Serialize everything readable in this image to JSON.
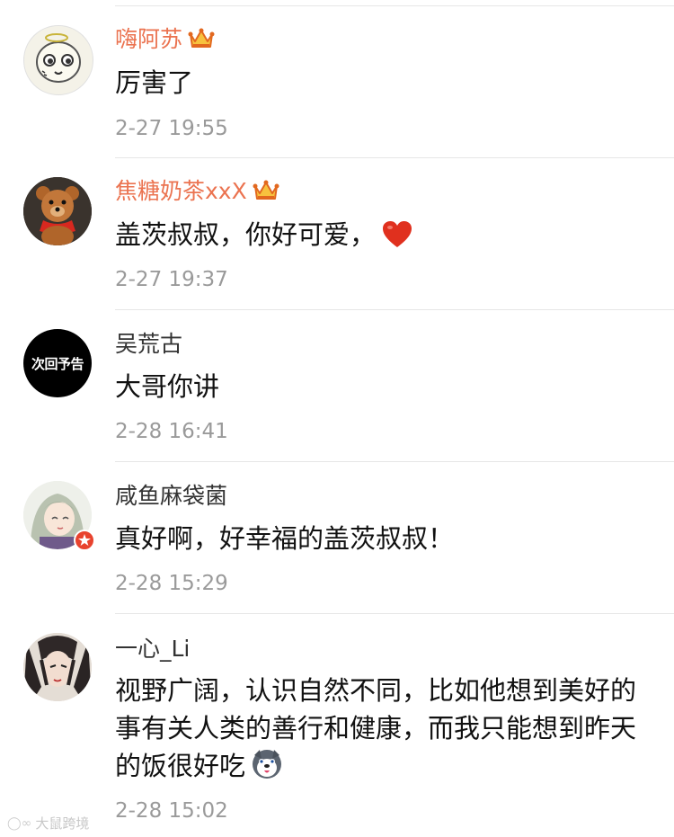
{
  "comments": [
    {
      "username": "嗨阿苏",
      "vip": true,
      "text": "厉害了",
      "time": "2-27 19:55",
      "avatar_icon": "doodle-face-avatar"
    },
    {
      "username": "焦糖奶茶xxX",
      "vip": true,
      "text": "盖茨叔叔，你好可爱，",
      "emoji": "heart-emoji",
      "time": "2-27 19:37",
      "avatar_icon": "teddy-bear-avatar"
    },
    {
      "username": "吴荒古",
      "vip": false,
      "text": "大哥你讲",
      "time": "2-28 16:41",
      "avatar_icon": "text-avatar",
      "avatar_text": "次回予告"
    },
    {
      "username": "咸鱼麻袋菌",
      "vip": false,
      "text": "真好啊，好幸福的盖茨叔叔！",
      "time": "2-28 15:29",
      "avatar_icon": "anime-girl-avatar"
    },
    {
      "username": "一心_Li",
      "vip": false,
      "text": "视野广阔，认识自然不同，比如他想到美好的事有关人类的善行和健康，而我只能想到昨天的饭很好吃",
      "emoji": "husky-emoji",
      "time": "2-28 15:02",
      "avatar_icon": "anime-character-avatar"
    }
  ],
  "watermark": {
    "text": "大鼠跨境"
  },
  "colors": {
    "vip_name": "#eb7350",
    "time": "#9a9a9a",
    "divider": "#e6e6e6"
  }
}
